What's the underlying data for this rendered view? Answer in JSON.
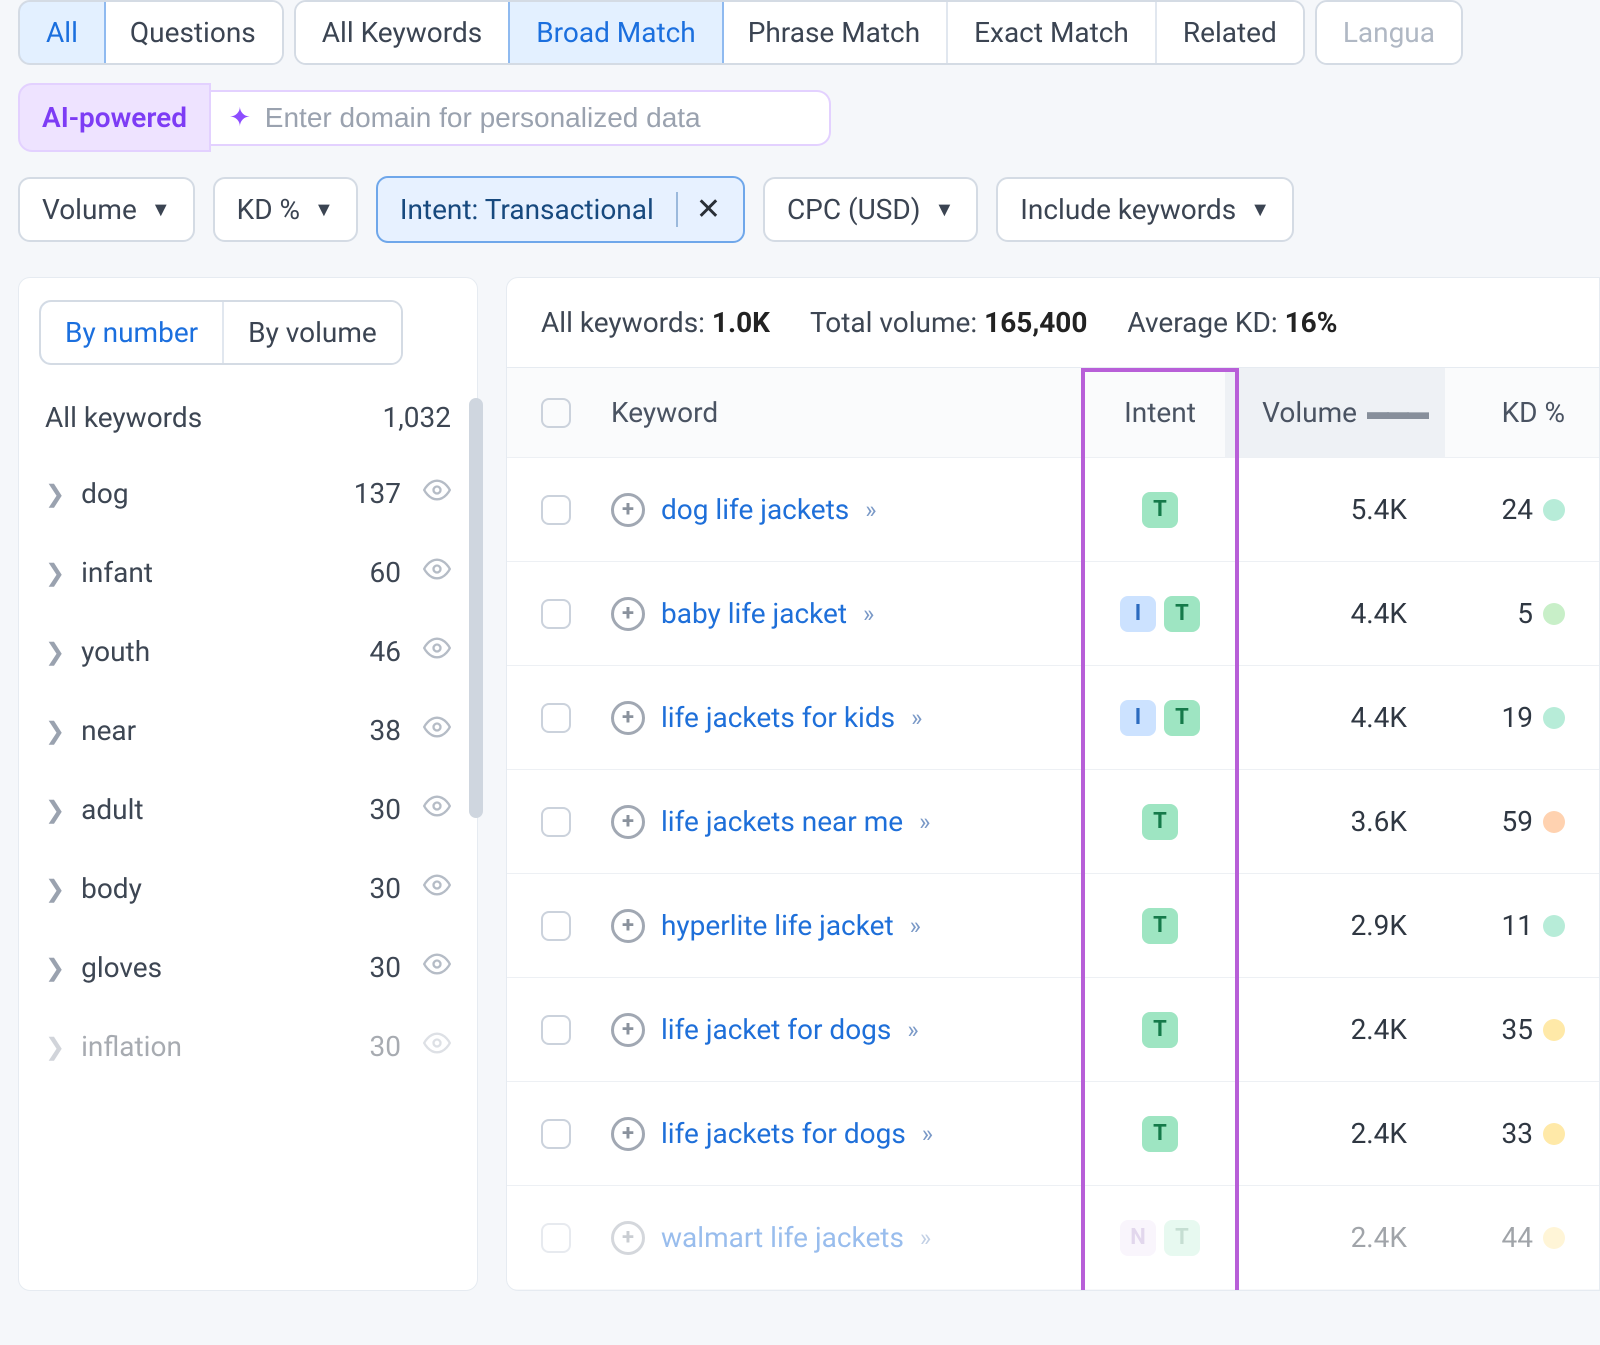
{
  "tabs1": {
    "all": "All",
    "questions": "Questions"
  },
  "tabs2": {
    "all_keywords": "All Keywords",
    "broad_match": "Broad Match",
    "phrase_match": "Phrase Match",
    "exact_match": "Exact Match",
    "related": "Related"
  },
  "tabs3": {
    "languages": "Langua"
  },
  "ai": {
    "label": "AI-powered",
    "placeholder": "Enter domain for personalized data"
  },
  "filters": {
    "volume": "Volume",
    "kd": "KD %",
    "intent": "Intent: Transactional",
    "cpc": "CPC (USD)",
    "include": "Include keywords"
  },
  "sidebar": {
    "seg": {
      "by_number": "By number",
      "by_volume": "By volume"
    },
    "head_label": "All keywords",
    "head_count": "1,032",
    "items": [
      {
        "label": "dog",
        "count": "137"
      },
      {
        "label": "infant",
        "count": "60"
      },
      {
        "label": "youth",
        "count": "46"
      },
      {
        "label": "near",
        "count": "38"
      },
      {
        "label": "adult",
        "count": "30"
      },
      {
        "label": "body",
        "count": "30"
      },
      {
        "label": "gloves",
        "count": "30"
      },
      {
        "label": "inflation",
        "count": "30"
      }
    ]
  },
  "summary": {
    "all_kw_label": "All keywords:",
    "all_kw_value": "1.0K",
    "total_vol_label": "Total volume:",
    "total_vol_value": "165,400",
    "avg_kd_label": "Average KD:",
    "avg_kd_value": "16%"
  },
  "columns": {
    "keyword": "Keyword",
    "intent": "Intent",
    "volume": "Volume",
    "kd": "KD %"
  },
  "rows": [
    {
      "keyword": "dog life jackets",
      "intents": [
        "T"
      ],
      "volume": "5.4K",
      "kd": "24",
      "kd_class": "kd-green"
    },
    {
      "keyword": "baby life jacket",
      "intents": [
        "I",
        "T"
      ],
      "volume": "4.4K",
      "kd": "5",
      "kd_class": "kd-lightgreen"
    },
    {
      "keyword": "life jackets for kids",
      "intents": [
        "I",
        "T"
      ],
      "volume": "4.4K",
      "kd": "19",
      "kd_class": "kd-green"
    },
    {
      "keyword": "life jackets near me",
      "intents": [
        "T"
      ],
      "volume": "3.6K",
      "kd": "59",
      "kd_class": "kd-orange"
    },
    {
      "keyword": "hyperlite life jacket",
      "intents": [
        "T"
      ],
      "volume": "2.9K",
      "kd": "11",
      "kd_class": "kd-green"
    },
    {
      "keyword": "life jacket for dogs",
      "intents": [
        "T"
      ],
      "volume": "2.4K",
      "kd": "35",
      "kd_class": "kd-yellow"
    },
    {
      "keyword": "life jackets for dogs",
      "intents": [
        "T"
      ],
      "volume": "2.4K",
      "kd": "33",
      "kd_class": "kd-yellow"
    },
    {
      "keyword": "walmart life jackets",
      "intents": [
        "N",
        "T"
      ],
      "volume": "2.4K",
      "kd": "44",
      "kd_class": "kd-yellow",
      "faded": true
    }
  ]
}
